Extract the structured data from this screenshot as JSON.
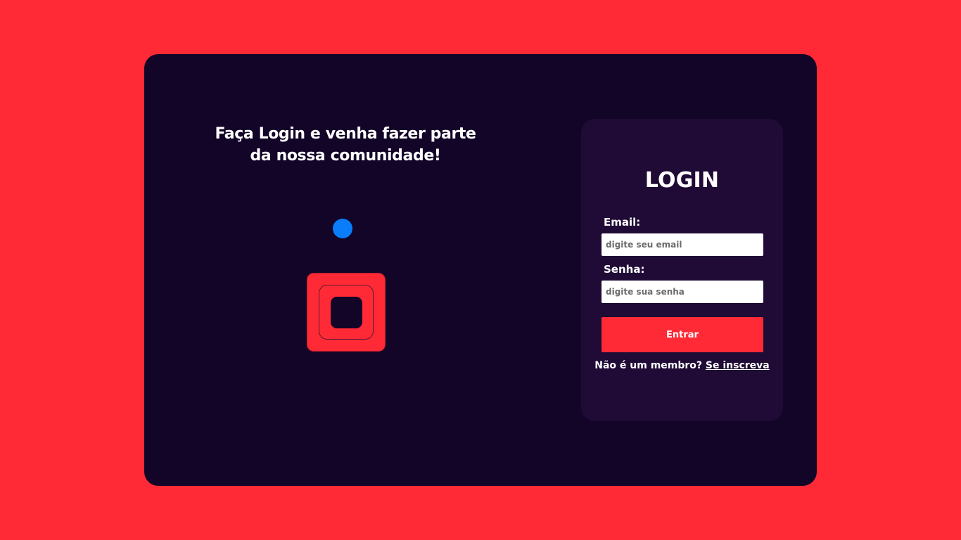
{
  "colors": {
    "background": "#ff2a35",
    "card": "#130528",
    "panel": "#1f0b35",
    "accent": "#ff2a35",
    "dot": "#0a7dfb"
  },
  "intro": {
    "headline": "Faça Login e venha fazer parte da nossa comunidade!"
  },
  "illustration": {
    "dot_icon": "blue-dot-icon",
    "logo_icon": "rounded-square-logo-icon"
  },
  "login": {
    "title": "LOGIN",
    "email": {
      "label": "Email:",
      "placeholder": "digite seu email",
      "value": ""
    },
    "password": {
      "label": "Senha:",
      "placeholder": "digite sua senha",
      "value": ""
    },
    "submit_label": "Entrar",
    "signup_prompt": "Não é um membro?",
    "signup_link": "Se inscreva"
  }
}
